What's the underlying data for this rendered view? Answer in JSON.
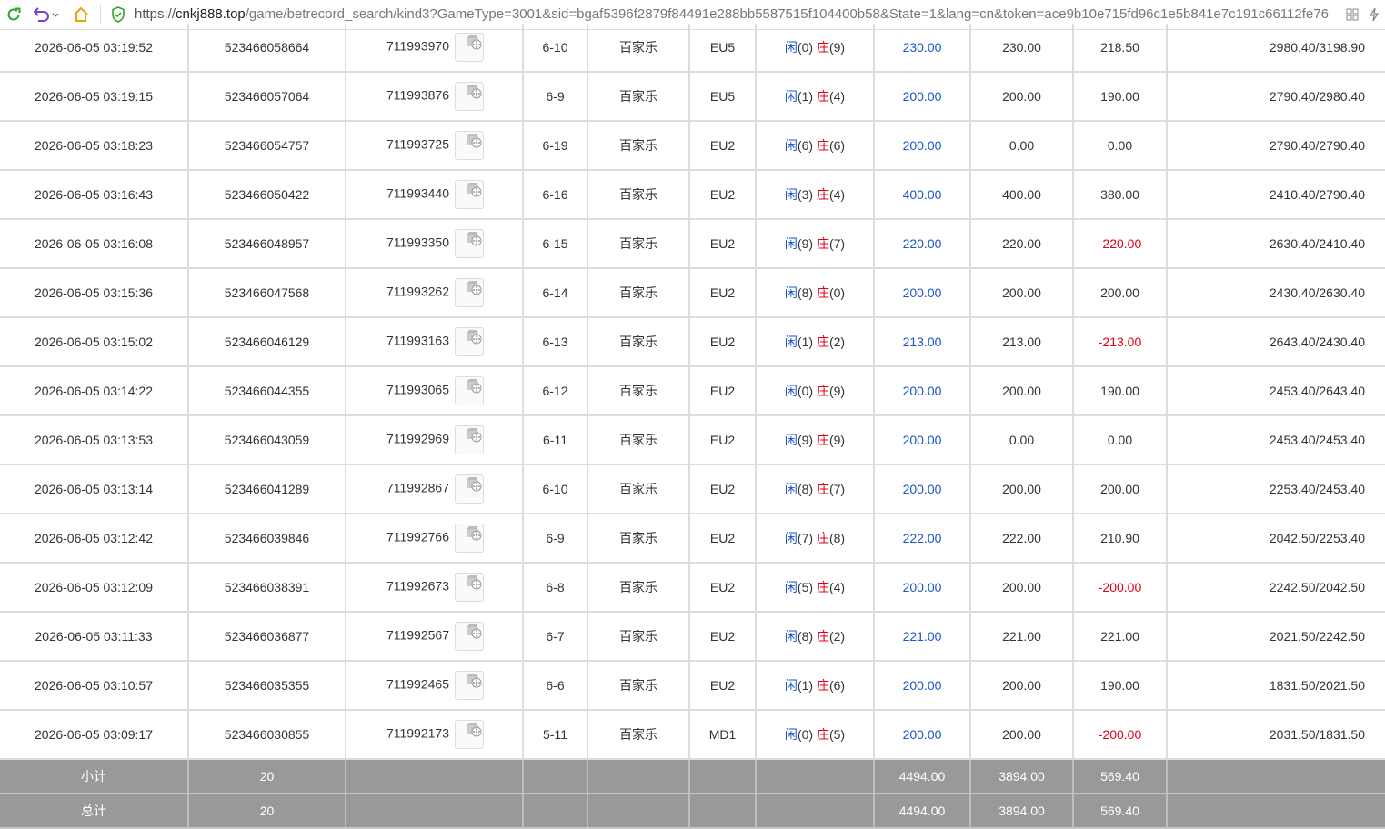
{
  "browser": {
    "url_proto": "https://",
    "url_host": "cnkj888.top",
    "url_path": "/game/betrecord_search/kind3?GameType=3001&sid=bgaf5396f2879f84491e288bb5587515f104400b58&State=1&lang=cn&token=ace9b10e715fd96c1e5b841e7c191c66112fe76",
    "icons": [
      "refresh-icon",
      "undo-icon",
      "home-icon",
      "shield-icon",
      "grid-icon",
      "lightning-icon"
    ],
    "accent": "#2aa82a"
  },
  "rows": [
    {
      "time": "2026-06-05 03:19:52",
      "order": "523466058664",
      "round": "711993970",
      "table": "6-10",
      "game": "百家乐",
      "room": "EU5",
      "player": "0",
      "banker": "9",
      "bet": "230.00",
      "valid": "230.00",
      "win": "218.50",
      "win_neg": false,
      "balance": "2980.40/3198.90"
    },
    {
      "time": "2026-06-05 03:19:15",
      "order": "523466057064",
      "round": "711993876",
      "table": "6-9",
      "game": "百家乐",
      "room": "EU5",
      "player": "1",
      "banker": "4",
      "bet": "200.00",
      "valid": "200.00",
      "win": "190.00",
      "win_neg": false,
      "balance": "2790.40/2980.40"
    },
    {
      "time": "2026-06-05 03:18:23",
      "order": "523466054757",
      "round": "711993725",
      "table": "6-19",
      "game": "百家乐",
      "room": "EU2",
      "player": "6",
      "banker": "6",
      "bet": "200.00",
      "valid": "0.00",
      "win": "0.00",
      "win_neg": false,
      "balance": "2790.40/2790.40"
    },
    {
      "time": "2026-06-05 03:16:43",
      "order": "523466050422",
      "round": "711993440",
      "table": "6-16",
      "game": "百家乐",
      "room": "EU2",
      "player": "3",
      "banker": "4",
      "bet": "400.00",
      "valid": "400.00",
      "win": "380.00",
      "win_neg": false,
      "balance": "2410.40/2790.40"
    },
    {
      "time": "2026-06-05 03:16:08",
      "order": "523466048957",
      "round": "711993350",
      "table": "6-15",
      "game": "百家乐",
      "room": "EU2",
      "player": "9",
      "banker": "7",
      "bet": "220.00",
      "valid": "220.00",
      "win": "-220.00",
      "win_neg": true,
      "balance": "2630.40/2410.40"
    },
    {
      "time": "2026-06-05 03:15:36",
      "order": "523466047568",
      "round": "711993262",
      "table": "6-14",
      "game": "百家乐",
      "room": "EU2",
      "player": "8",
      "banker": "0",
      "bet": "200.00",
      "valid": "200.00",
      "win": "200.00",
      "win_neg": false,
      "balance": "2430.40/2630.40"
    },
    {
      "time": "2026-06-05 03:15:02",
      "order": "523466046129",
      "round": "711993163",
      "table": "6-13",
      "game": "百家乐",
      "room": "EU2",
      "player": "1",
      "banker": "2",
      "bet": "213.00",
      "valid": "213.00",
      "win": "-213.00",
      "win_neg": true,
      "balance": "2643.40/2430.40"
    },
    {
      "time": "2026-06-05 03:14:22",
      "order": "523466044355",
      "round": "711993065",
      "table": "6-12",
      "game": "百家乐",
      "room": "EU2",
      "player": "0",
      "banker": "9",
      "bet": "200.00",
      "valid": "200.00",
      "win": "190.00",
      "win_neg": false,
      "balance": "2453.40/2643.40"
    },
    {
      "time": "2026-06-05 03:13:53",
      "order": "523466043059",
      "round": "711992969",
      "table": "6-11",
      "game": "百家乐",
      "room": "EU2",
      "player": "9",
      "banker": "9",
      "bet": "200.00",
      "valid": "0.00",
      "win": "0.00",
      "win_neg": false,
      "balance": "2453.40/2453.40"
    },
    {
      "time": "2026-06-05 03:13:14",
      "order": "523466041289",
      "round": "711992867",
      "table": "6-10",
      "game": "百家乐",
      "room": "EU2",
      "player": "8",
      "banker": "7",
      "bet": "200.00",
      "valid": "200.00",
      "win": "200.00",
      "win_neg": false,
      "balance": "2253.40/2453.40"
    },
    {
      "time": "2026-06-05 03:12:42",
      "order": "523466039846",
      "round": "711992766",
      "table": "6-9",
      "game": "百家乐",
      "room": "EU2",
      "player": "7",
      "banker": "8",
      "bet": "222.00",
      "valid": "222.00",
      "win": "210.90",
      "win_neg": false,
      "balance": "2042.50/2253.40"
    },
    {
      "time": "2026-06-05 03:12:09",
      "order": "523466038391",
      "round": "711992673",
      "table": "6-8",
      "game": "百家乐",
      "room": "EU2",
      "player": "5",
      "banker": "4",
      "bet": "200.00",
      "valid": "200.00",
      "win": "-200.00",
      "win_neg": true,
      "balance": "2242.50/2042.50"
    },
    {
      "time": "2026-06-05 03:11:33",
      "order": "523466036877",
      "round": "711992567",
      "table": "6-7",
      "game": "百家乐",
      "room": "EU2",
      "player": "8",
      "banker": "2",
      "bet": "221.00",
      "valid": "221.00",
      "win": "221.00",
      "win_neg": false,
      "balance": "2021.50/2242.50"
    },
    {
      "time": "2026-06-05 03:10:57",
      "order": "523466035355",
      "round": "711992465",
      "table": "6-6",
      "game": "百家乐",
      "room": "EU2",
      "player": "1",
      "banker": "6",
      "bet": "200.00",
      "valid": "200.00",
      "win": "190.00",
      "win_neg": false,
      "balance": "1831.50/2021.50"
    },
    {
      "time": "2026-06-05 03:09:17",
      "order": "523466030855",
      "round": "711992173",
      "table": "5-11",
      "game": "百家乐",
      "room": "MD1",
      "player": "0",
      "banker": "5",
      "bet": "200.00",
      "valid": "200.00",
      "win": "-200.00",
      "win_neg": true,
      "balance": "2031.50/1831.50"
    }
  ],
  "labels": {
    "player": "闲",
    "banker": "庄"
  },
  "subtotal": {
    "label": "小计",
    "count": "20",
    "bet": "4494.00",
    "valid": "3894.00",
    "win": "569.40"
  },
  "total": {
    "label": "总计",
    "count": "20",
    "bet": "4494.00",
    "valid": "3894.00",
    "win": "569.40"
  },
  "colors": {
    "blue": "#1a56c8",
    "red": "#e0001a",
    "summary_bg": "#999999"
  }
}
